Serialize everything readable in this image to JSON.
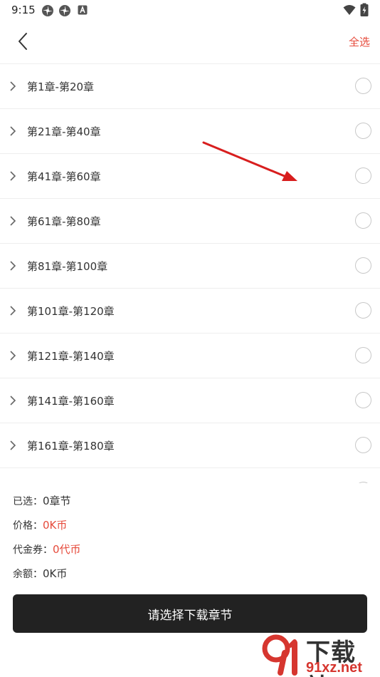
{
  "status_bar": {
    "time": "9:15",
    "left_icons": [
      "pinwheel-icon",
      "pinwheel-icon",
      "a-box-icon"
    ],
    "right_icons": [
      "wifi-icon",
      "battery-icon"
    ]
  },
  "header": {
    "back_icon": "chevron-left-icon",
    "select_all_label": "全选"
  },
  "chapters": [
    {
      "label": "第1章-第20章",
      "selected": false
    },
    {
      "label": "第21章-第40章",
      "selected": false
    },
    {
      "label": "第41章-第60章",
      "selected": false
    },
    {
      "label": "第61章-第80章",
      "selected": false
    },
    {
      "label": "第81章-第100章",
      "selected": false
    },
    {
      "label": "第101章-第120章",
      "selected": false
    },
    {
      "label": "第121章-第140章",
      "selected": false
    },
    {
      "label": "第141章-第160章",
      "selected": false
    },
    {
      "label": "第161章-第180章",
      "selected": false
    },
    {
      "label": "",
      "selected": false
    }
  ],
  "summary": {
    "selected_label": "已选：",
    "selected_value": "0章节",
    "price_label": "价格：",
    "price_value": "0K币",
    "voucher_label": "代金券：",
    "voucher_value": "0代币",
    "balance_label": "余额：",
    "balance_value": "0K币"
  },
  "download_button_label": "请选择下载章节",
  "watermark": {
    "title": "下载站",
    "url": "91xz.net"
  },
  "colors": {
    "accent": "#e64a3b",
    "button_bg": "#222222",
    "arrow": "#d81e1e"
  }
}
